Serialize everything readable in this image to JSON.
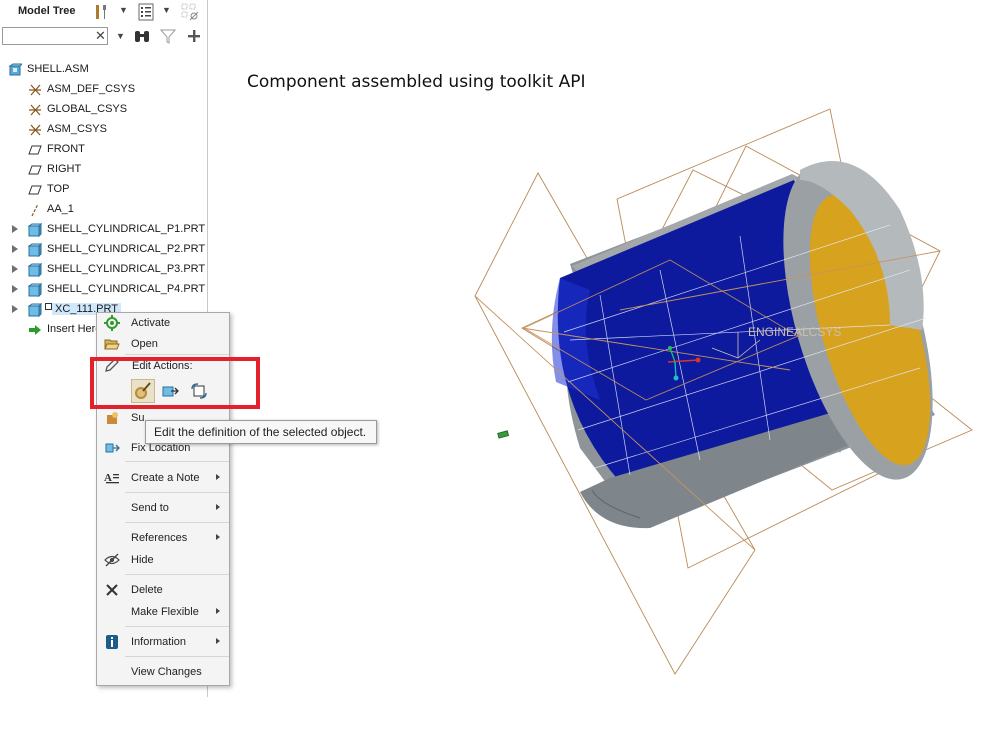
{
  "toolbar": {
    "title": "Model Tree"
  },
  "search": {
    "value": "",
    "clear": "✕"
  },
  "tree": {
    "items": [
      {
        "label": "SHELL.ASM",
        "icon": "assembly-icon"
      },
      {
        "label": "ASM_DEF_CSYS",
        "icon": "csys-icon"
      },
      {
        "label": "GLOBAL_CSYS",
        "icon": "csys-icon"
      },
      {
        "label": "ASM_CSYS",
        "icon": "csys-icon"
      },
      {
        "label": "FRONT",
        "icon": "datum-plane-icon"
      },
      {
        "label": "RIGHT",
        "icon": "datum-plane-icon"
      },
      {
        "label": "TOP",
        "icon": "datum-plane-icon"
      },
      {
        "label": "AA_1",
        "icon": "datum-axis-icon"
      },
      {
        "label": "SHELL_CYLINDRICAL_P1.PRT",
        "icon": "part-icon"
      },
      {
        "label": "SHELL_CYLINDRICAL_P2.PRT",
        "icon": "part-icon"
      },
      {
        "label": "SHELL_CYLINDRICAL_P3.PRT",
        "icon": "part-icon"
      },
      {
        "label": "SHELL_CYLINDRICAL_P4.PRT",
        "icon": "part-icon"
      },
      {
        "label": "XC_111.PRT",
        "icon": "part-icon"
      },
      {
        "label": "Insert Here",
        "icon": "insert-arrow-icon"
      }
    ]
  },
  "viewport": {
    "caption": "Component assembled using toolkit API",
    "csys_label": "ENGINEALCSYS",
    "colors": {
      "blue_face": "#0d1a9e",
      "gold_face": "#d7a21e",
      "grey_face": "#8c9296",
      "datum_plane": "#c9965a"
    }
  },
  "context_menu": {
    "activate": "Activate",
    "open": "Open",
    "edit_actions": "Edit Actions:",
    "suppress": "Su",
    "fix_location": "Fix Location",
    "create_note": "Create a Note",
    "send_to": "Send to",
    "references": "References",
    "hide": "Hide",
    "delete": "Delete",
    "make_flexible": "Make Flexible",
    "information": "Information",
    "view_changes": "View Changes"
  },
  "tooltip": {
    "text": "Edit the definition of the selected object."
  }
}
